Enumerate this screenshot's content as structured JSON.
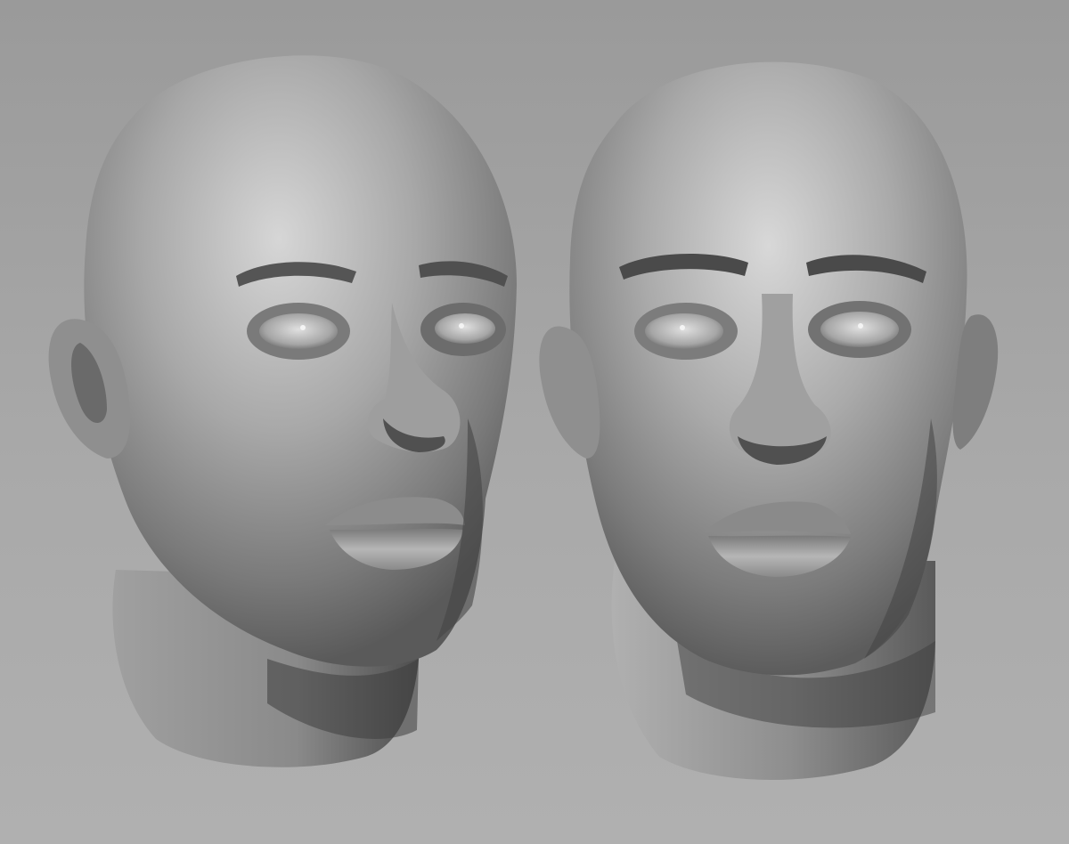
{
  "scene": {
    "kind": "3D sculpt render",
    "background": {
      "top": "#9a9a9a",
      "bottom": "#b0b0b0"
    },
    "material": {
      "base": "#9c9c9c",
      "highlight": "#d8d8d8",
      "shadow": "#4a4a4a"
    },
    "heads": [
      {
        "view": "three-quarter",
        "facing": "right"
      },
      {
        "view": "front",
        "facing": "viewer"
      }
    ]
  }
}
